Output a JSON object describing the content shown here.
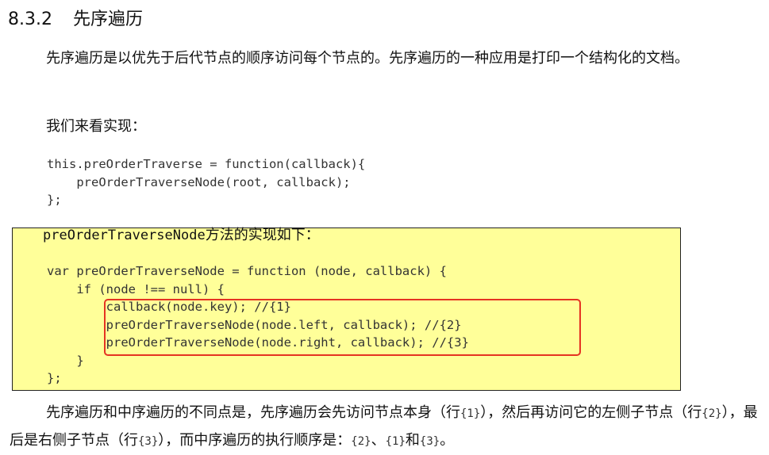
{
  "section": {
    "number": "8.3.2",
    "title": "先序遍历"
  },
  "intro_paragraph": "先序遍历是以优先于后代节点的顺序访问每个节点的。先序遍历的一种应用是打印一个结构化的文档。",
  "lead_in": "我们来看实现：",
  "code_block_1": [
    "this.preOrderTraverse = function(callback){",
    "    preOrderTraverseNode(root, callback);",
    "};"
  ],
  "box_intro": {
    "code_term": "preOrderTraverseNode",
    "text": "方法的实现如下："
  },
  "code_block_2": [
    "var preOrderTraverseNode = function (node, callback) {",
    "    if (node !== null) {",
    "        callback(node.key); //{1}",
    "        preOrderTraverseNode(node.left, callback); //{2}",
    "        preOrderTraverseNode(node.right, callback); //{3}",
    "    }",
    "};"
  ],
  "closing_paragraph": {
    "t1": "先序遍历和中序遍历的不同点是，先序遍历会先访问节点本身（行",
    "c1": "{1}",
    "t2": "），然后再访问它的左侧子节点（行",
    "c2": "{2}",
    "t3": "），最后是右侧子节点（行",
    "c3": "{3}",
    "t4": "），而中序遍历的执行顺序是：",
    "c4": "{2}",
    "t5": "、",
    "c5": "{1}",
    "t6": "和",
    "c6": "{3}",
    "t7": "。"
  },
  "colors": {
    "code_box_bg": "#ffff99",
    "highlight_border": "#e53322"
  }
}
